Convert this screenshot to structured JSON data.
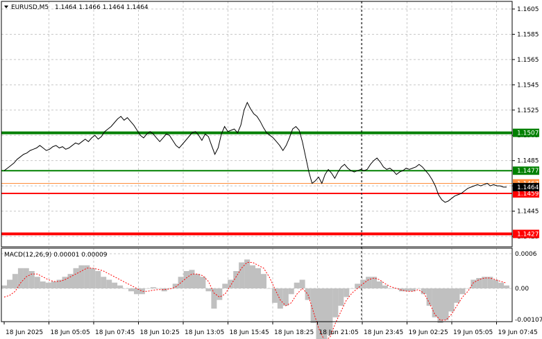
{
  "colors": {
    "background": "#ffffff",
    "grid": "#c8c8c8",
    "price_line": "#000000",
    "support_resistance_green": "#008000",
    "support_resistance_red": "#ff0000",
    "orange_level": "#ff8c3a",
    "current_price_tag": "#000000",
    "macd_histogram": "#c0c0c0",
    "macd_signal": "#ff0000",
    "axis_text": "#000000"
  },
  "header": {
    "symbol_timeframe": "EURUSD,M5",
    "ohlc": "1.1464 1.1466 1.1464 1.1464",
    "dropdown_icon": "triangle-down-icon"
  },
  "price_axis": {
    "ticks": [
      "1.1605",
      "1.1585",
      "1.1565",
      "1.1545",
      "1.1525",
      "1.1505",
      "1.1485",
      "1.1465",
      "1.1445",
      "1.1425"
    ],
    "tick_values": [
      1.1605,
      1.1585,
      1.1565,
      1.1545,
      1.1525,
      1.1505,
      1.1485,
      1.1465,
      1.1445,
      1.1425
    ]
  },
  "levels": [
    {
      "label": "1.1507",
      "value": 1.1507,
      "color": "#008000",
      "thick": true
    },
    {
      "label": "1.1477",
      "value": 1.1477,
      "color": "#008000",
      "thick": false
    },
    {
      "label": "1.1467",
      "value": 1.1467,
      "color": "#ff8c3a",
      "thick": false
    },
    {
      "label": "1.1459",
      "value": 1.1459,
      "color": "#ff0000",
      "thick": false
    },
    {
      "label": "1.1427",
      "value": 1.1427,
      "color": "#ff0000",
      "thick": true
    }
  ],
  "current_price": {
    "label": "1.1464",
    "value": 1.1464
  },
  "macd": {
    "title": "MACD(12,26,9) 0.00001 0.00009",
    "ticks": [
      "0.0006",
      "0.00",
      "-0.00107"
    ],
    "tick_values": [
      0.0006,
      0.0,
      -0.00107
    ]
  },
  "time_axis": {
    "labels": [
      "18 Jun 2025",
      "18 Jun 05:05",
      "18 Jun 07:45",
      "18 Jun 10:25",
      "18 Jun 13:05",
      "18 Jun 15:45",
      "18 Jun 18:25",
      "18 Jun 21:05",
      "18 Jun 23:45",
      "19 Jun 02:25",
      "19 Jun 05:05",
      "19 Jun 07:45"
    ]
  },
  "chart_data": {
    "type": "line",
    "title": "EURUSD,M5",
    "ylim": [
      1.1425,
      1.161
    ],
    "series": [
      {
        "name": "EURUSD",
        "values": [
          1.1477,
          1.1479,
          1.1481,
          1.1483,
          1.1486,
          1.1488,
          1.149,
          1.1491,
          1.1493,
          1.1494,
          1.1495,
          1.1497,
          1.1495,
          1.1493,
          1.1494,
          1.1496,
          1.1497,
          1.1495,
          1.1496,
          1.1494,
          1.1495,
          1.1497,
          1.1499,
          1.1498,
          1.15,
          1.1502,
          1.15,
          1.1503,
          1.1505,
          1.1502,
          1.1504,
          1.1508,
          1.151,
          1.1512,
          1.1515,
          1.1518,
          1.152,
          1.1517,
          1.1519,
          1.1516,
          1.1513,
          1.1509,
          1.1505,
          1.1503,
          1.1506,
          1.1508,
          1.1506,
          1.1503,
          1.15,
          1.1503,
          1.1506,
          1.1505,
          1.1501,
          1.1497,
          1.1495,
          1.1498,
          1.1501,
          1.1504,
          1.1507,
          1.1508,
          1.1505,
          1.1501,
          1.1506,
          1.1504,
          1.1497,
          1.149,
          1.1495,
          1.1506,
          1.1512,
          1.1508,
          1.1509,
          1.151,
          1.1507,
          1.1513,
          1.1525,
          1.1531,
          1.1526,
          1.1522,
          1.152,
          1.1516,
          1.1511,
          1.1507,
          1.1505,
          1.1503,
          1.15,
          1.1497,
          1.1493,
          1.1497,
          1.1503,
          1.151,
          1.1512,
          1.1509,
          1.15,
          1.1488,
          1.1476,
          1.1467,
          1.1469,
          1.1472,
          1.1467,
          1.1474,
          1.1478,
          1.1475,
          1.1471,
          1.1476,
          1.148,
          1.1482,
          1.1479,
          1.1477,
          1.1476,
          1.1477,
          1.1478,
          1.1477,
          1.1478,
          1.1482,
          1.1485,
          1.1487,
          1.1484,
          1.148,
          1.1478,
          1.1479,
          1.1477,
          1.1474,
          1.1476,
          1.1477,
          1.1479,
          1.1478,
          1.1479,
          1.148,
          1.1482,
          1.148,
          1.1477,
          1.1474,
          1.147,
          1.1465,
          1.1458,
          1.1454,
          1.1452,
          1.1453,
          1.1455,
          1.1457,
          1.1458,
          1.1459,
          1.1461,
          1.1463,
          1.1464,
          1.1465,
          1.1466,
          1.1465,
          1.1466,
          1.1467,
          1.1465,
          1.1466,
          1.1465,
          1.1465,
          1.1464,
          1.1464
        ]
      },
      {
        "name": "MACD",
        "values": [
          5e-05,
          0.00015,
          0.00025,
          0.00035,
          0.00035,
          0.0003,
          0.0002,
          0.00012,
          0.0001,
          0.00012,
          0.00015,
          0.0002,
          0.00025,
          0.00035,
          0.0004,
          0.0004,
          0.00035,
          0.0003,
          0.0002,
          0.00015,
          0.0001,
          5e-05,
          0.0,
          -5e-05,
          -0.0001,
          -0.0001,
          0.0,
          2e-05,
          0.0,
          -5e-05,
          0.0,
          8e-05,
          0.0002,
          0.0003,
          0.00032,
          0.00025,
          0.0002,
          -5e-05,
          -0.00035,
          -0.0002,
          8e-05,
          0.00015,
          0.0003,
          0.00045,
          0.0005,
          0.0004,
          0.00035,
          0.00025,
          0.0,
          -0.00025,
          -0.00035,
          -0.0003,
          -0.0001,
          0.0001,
          0.00015,
          -0.0002,
          -0.0006,
          -0.00095,
          -0.00105,
          -0.0008,
          -0.0005,
          -0.0003,
          -0.00015,
          0.0,
          8e-05,
          0.00015,
          0.0002,
          0.0002,
          0.00012,
          5e-05,
          0.0,
          0.0,
          -5e-05,
          -5e-05,
          -5e-05,
          0.0,
          -0.0001,
          -0.0003,
          -0.0005,
          -0.0006,
          -0.00055,
          -0.0004,
          -0.00025,
          -0.0001,
          0.0,
          0.00015,
          0.00018,
          0.0002,
          0.0002,
          0.00015,
          0.0001,
          5e-05
        ]
      },
      {
        "name": "Signal",
        "values": [
          -0.00015,
          -0.00012,
          -5e-05,
          0.0001,
          0.0002,
          0.00025,
          0.00025,
          0.0002,
          0.00015,
          0.00012,
          0.00012,
          0.00015,
          0.0002,
          0.00025,
          0.0003,
          0.00035,
          0.00035,
          0.00033,
          0.0003,
          0.00025,
          0.0002,
          0.00015,
          0.0001,
          5e-05,
          0.0,
          -5e-05,
          -5e-05,
          -3e-05,
          -2e-05,
          -2e-05,
          -1e-05,
          2e-05,
          0.0001,
          0.00018,
          0.00025,
          0.00025,
          0.00022,
          0.00012,
          -8e-05,
          -0.00015,
          -0.0001,
          5e-05,
          0.0002,
          0.00035,
          0.00045,
          0.00045,
          0.0004,
          0.00035,
          0.0002,
          0.0,
          -0.0002,
          -0.0003,
          -0.00025,
          -0.0001,
          0.0,
          -0.0001,
          -0.0004,
          -0.0007,
          -0.0009,
          -0.00085,
          -0.0006,
          -0.0004,
          -0.0002,
          -8e-05,
          0.0,
          8e-05,
          0.00015,
          0.00018,
          0.00015,
          8e-05,
          3e-05,
          0.0,
          -3e-05,
          -5e-05,
          -5e-05,
          -2e-05,
          -8e-05,
          -0.00025,
          -0.00045,
          -0.00055,
          -0.00055,
          -0.00045,
          -0.0003,
          -0.00015,
          -5e-05,
          0.0001,
          0.00015,
          0.00018,
          0.00018,
          0.00015,
          0.00012,
          9e-05
        ]
      }
    ]
  }
}
